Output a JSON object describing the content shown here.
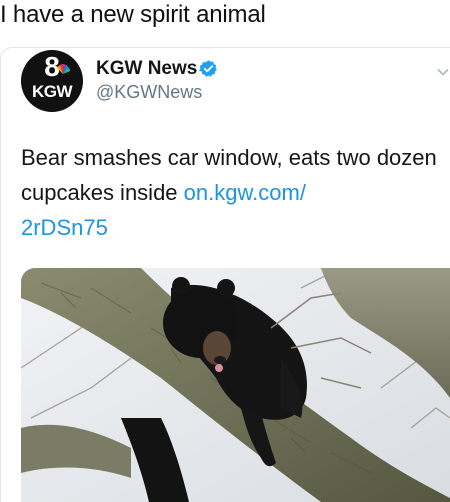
{
  "caption": "I have a new spirit animal",
  "tweet": {
    "avatar": {
      "number": "8",
      "station": "KGW"
    },
    "display_name": "KGW News",
    "handle": "@KGWNews",
    "text": "Bear smashes car window, eats two dozen cupcakes inside ",
    "link_line1": "on.kgw.com/",
    "link_line2": "2rDSn75",
    "photo_icon": "bear-in-tree-photo"
  },
  "colors": {
    "link": "#1b95e0",
    "verified": "#1da1f2",
    "handle": "#657786",
    "text": "#14171a"
  }
}
